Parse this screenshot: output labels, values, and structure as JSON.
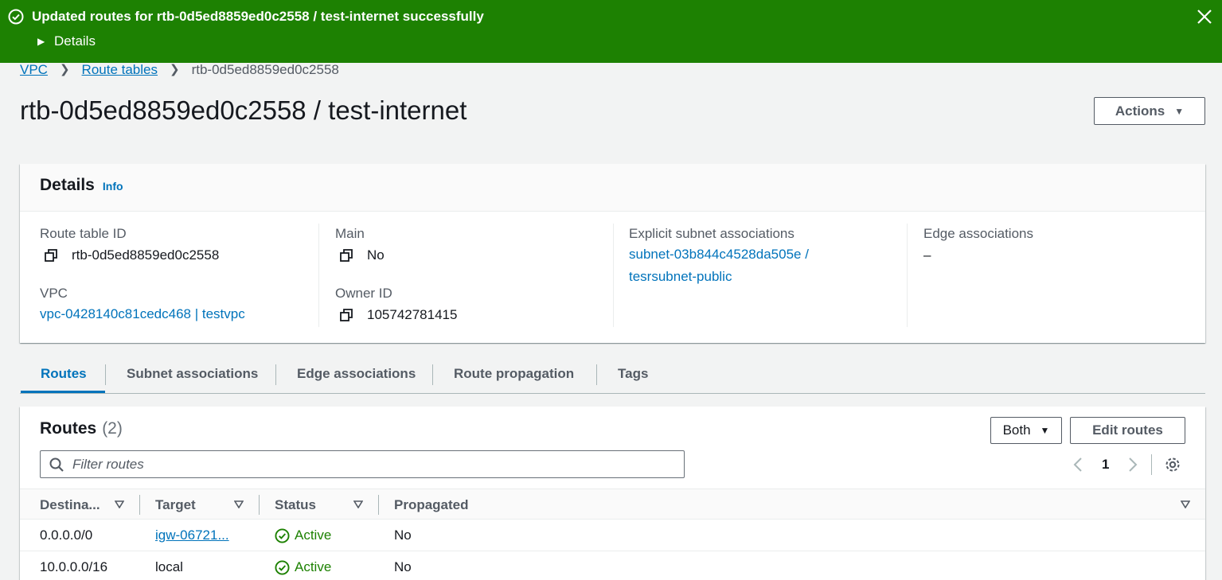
{
  "flash": {
    "message": "Updated routes for rtb-0d5ed8859ed0c2558 / test-internet successfully",
    "details_label": "Details",
    "color": "#1d8102",
    "icons": {
      "status": "check-circle-icon",
      "expand": "caret-right-icon",
      "close": "close-icon"
    }
  },
  "breadcrumb": {
    "items": [
      "VPC",
      "Route tables",
      "rtb-0d5ed8859ed0c2558"
    ]
  },
  "page": {
    "title": "rtb-0d5ed8859ed0c2558 / test-internet",
    "actions_label": "Actions"
  },
  "details": {
    "heading": "Details",
    "info_label": "Info",
    "route_table_id_label": "Route table ID",
    "route_table_id": "rtb-0d5ed8859ed0c2558",
    "vpc_label": "VPC",
    "vpc": "vpc-0428140c81cedc468 | testvpc",
    "main_label": "Main",
    "main": "No",
    "owner_label": "Owner ID",
    "owner": "105742781415",
    "subnet_assoc_label": "Explicit subnet associations",
    "subnet_assoc_line1": "subnet-03b844c4528da505e /",
    "subnet_assoc_line2": "tesrsubnet-public",
    "edge_assoc_label": "Edge associations",
    "edge_assoc": "–"
  },
  "tabs": [
    "Routes",
    "Subnet associations",
    "Edge associations",
    "Route propagation",
    "Tags"
  ],
  "routes": {
    "heading": "Routes",
    "count": "(2)",
    "filter_select": "Both",
    "edit_label": "Edit routes",
    "filter_placeholder": "Filter routes",
    "page_number": "1",
    "columns": [
      "Destina...",
      "Target",
      "Status",
      "Propagated"
    ],
    "rows": [
      {
        "destination": "0.0.0.0/0",
        "target": "igw-06721...",
        "target_is_link": true,
        "status": "Active",
        "propagated": "No"
      },
      {
        "destination": "10.0.0.0/16",
        "target": "local",
        "target_is_link": false,
        "status": "Active",
        "propagated": "No"
      }
    ]
  },
  "colors": {
    "link": "#0073bb",
    "success": "#1d8102",
    "text_secondary": "#545b64"
  }
}
